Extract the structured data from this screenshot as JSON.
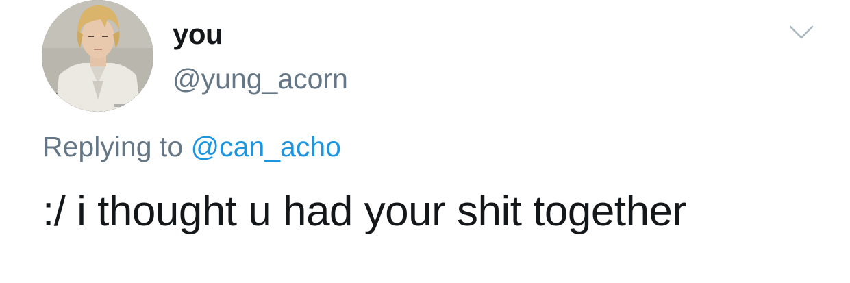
{
  "tweet": {
    "author": {
      "display_name": "you",
      "handle": "@yung_acorn"
    },
    "reply": {
      "prefix": "Replying to ",
      "mention": "@can_acho"
    },
    "text": ":/ i thought u had your shit together",
    "icons": {
      "menu": "chevron-down-icon"
    }
  },
  "colors": {
    "primary_text": "#14171a",
    "secondary_text": "#657786",
    "link": "#1b95e0",
    "background": "#ffffff"
  }
}
